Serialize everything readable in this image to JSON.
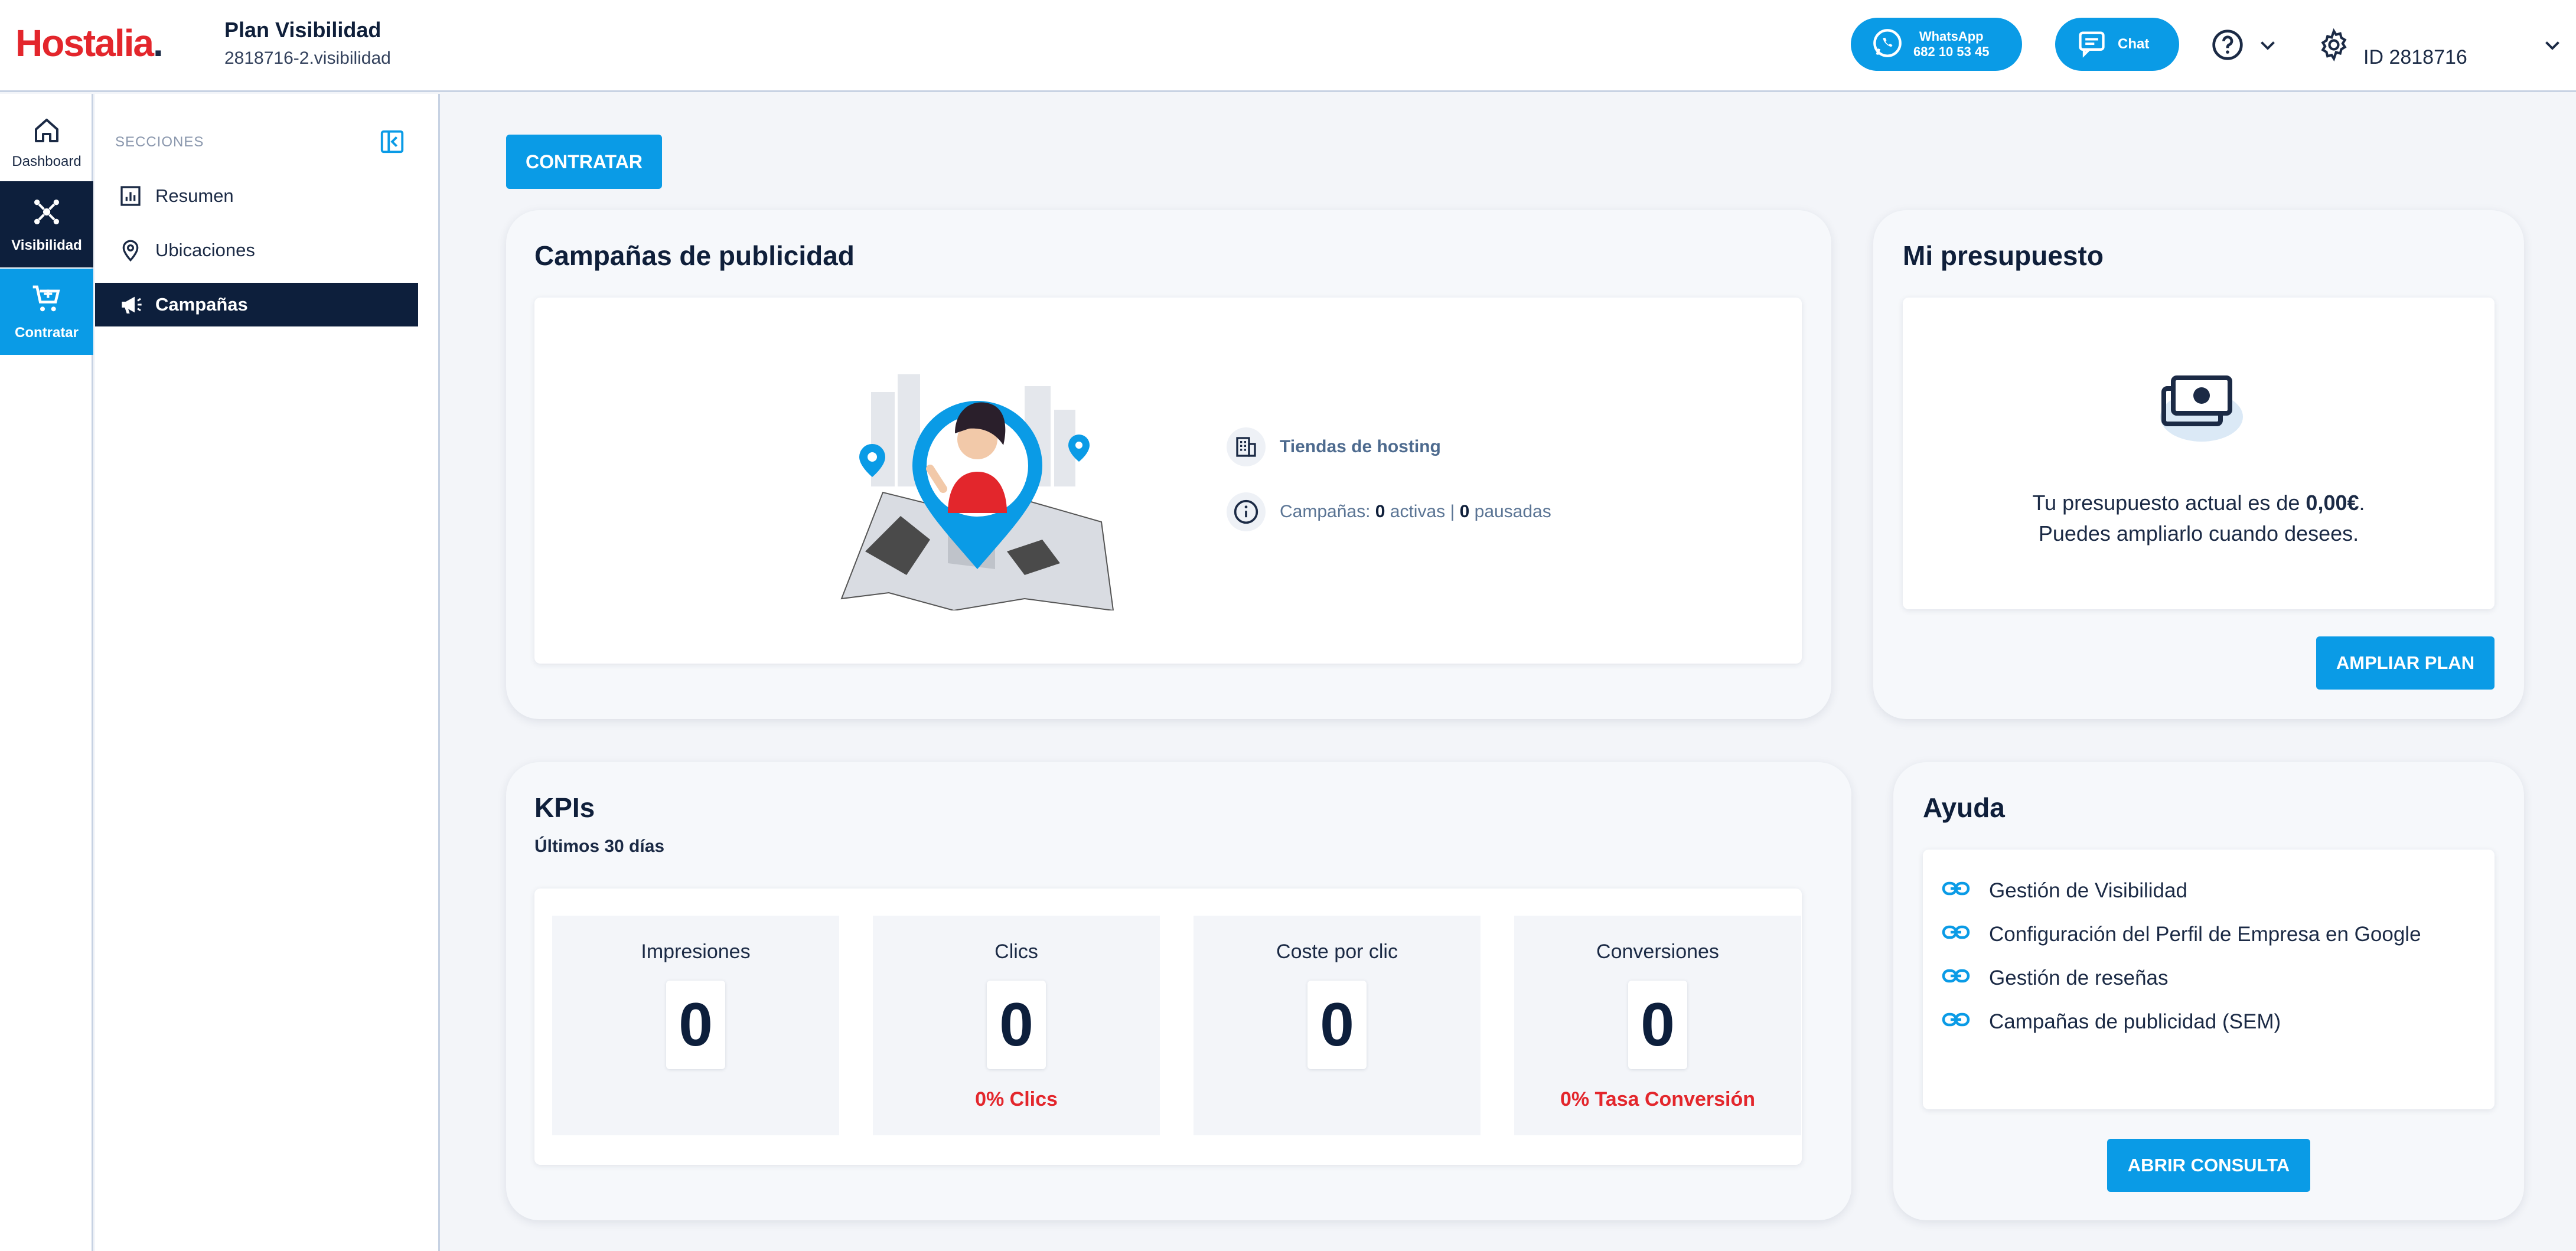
{
  "header": {
    "logo_text": "Hostalia",
    "logo_dot": ".",
    "plan_title": "Plan Visibilidad",
    "plan_subtitle": "2818716-2.visibilidad",
    "whatsapp_label": "WhatsApp",
    "whatsapp_phone": "682 10 53 45",
    "chat_label": "Chat",
    "account_id": "ID 2818716"
  },
  "rail": {
    "items": [
      {
        "label": "Dashboard",
        "icon": "home-icon"
      },
      {
        "label": "Visibilidad",
        "icon": "network-icon"
      },
      {
        "label": "Contratar",
        "icon": "cart-icon"
      }
    ]
  },
  "sections": {
    "heading": "SECCIONES",
    "items": [
      {
        "label": "Resumen",
        "icon": "chart-icon"
      },
      {
        "label": "Ubicaciones",
        "icon": "map-pin-icon"
      },
      {
        "label": "Campañas",
        "icon": "megaphone-icon"
      }
    ]
  },
  "main": {
    "contratar_button": "CONTRATAR",
    "campaigns": {
      "title": "Campañas de publicidad",
      "store_label": "Tiendas de hosting",
      "campaigns_prefix": "Campañas: ",
      "active_count": "0",
      "active_label": " activas | ",
      "paused_count": "0",
      "paused_label": " pausadas"
    },
    "budget": {
      "title": "Mi presupuesto",
      "line1_prefix": "Tu presupuesto actual es de ",
      "amount": "0,00€",
      "line1_suffix": ".",
      "line2": "Puedes ampliarlo cuando desees.",
      "button": "AMPLIAR PLAN"
    },
    "kpis": {
      "title": "KPIs",
      "subtitle": "Últimos 30 días",
      "items": [
        {
          "name": "Impresiones",
          "value": "0",
          "note": ""
        },
        {
          "name": "Clics",
          "value": "0",
          "note": "0% Clics"
        },
        {
          "name": "Coste por clic",
          "value": "0",
          "note": ""
        },
        {
          "name": "Conversiones",
          "value": "0",
          "note": "0% Tasa Conversión"
        }
      ]
    },
    "help": {
      "title": "Ayuda",
      "links": [
        "Gestión de Visibilidad",
        "Configuración del Perfil de Empresa en Google",
        "Gestión de reseñas",
        "Campañas de publicidad (SEM)"
      ],
      "button": "ABRIR CONSULTA"
    }
  },
  "colors": {
    "accent": "#0a9be6",
    "navy": "#0d1f3c",
    "brand_red": "#e3262c",
    "background": "#f3f5f9"
  }
}
